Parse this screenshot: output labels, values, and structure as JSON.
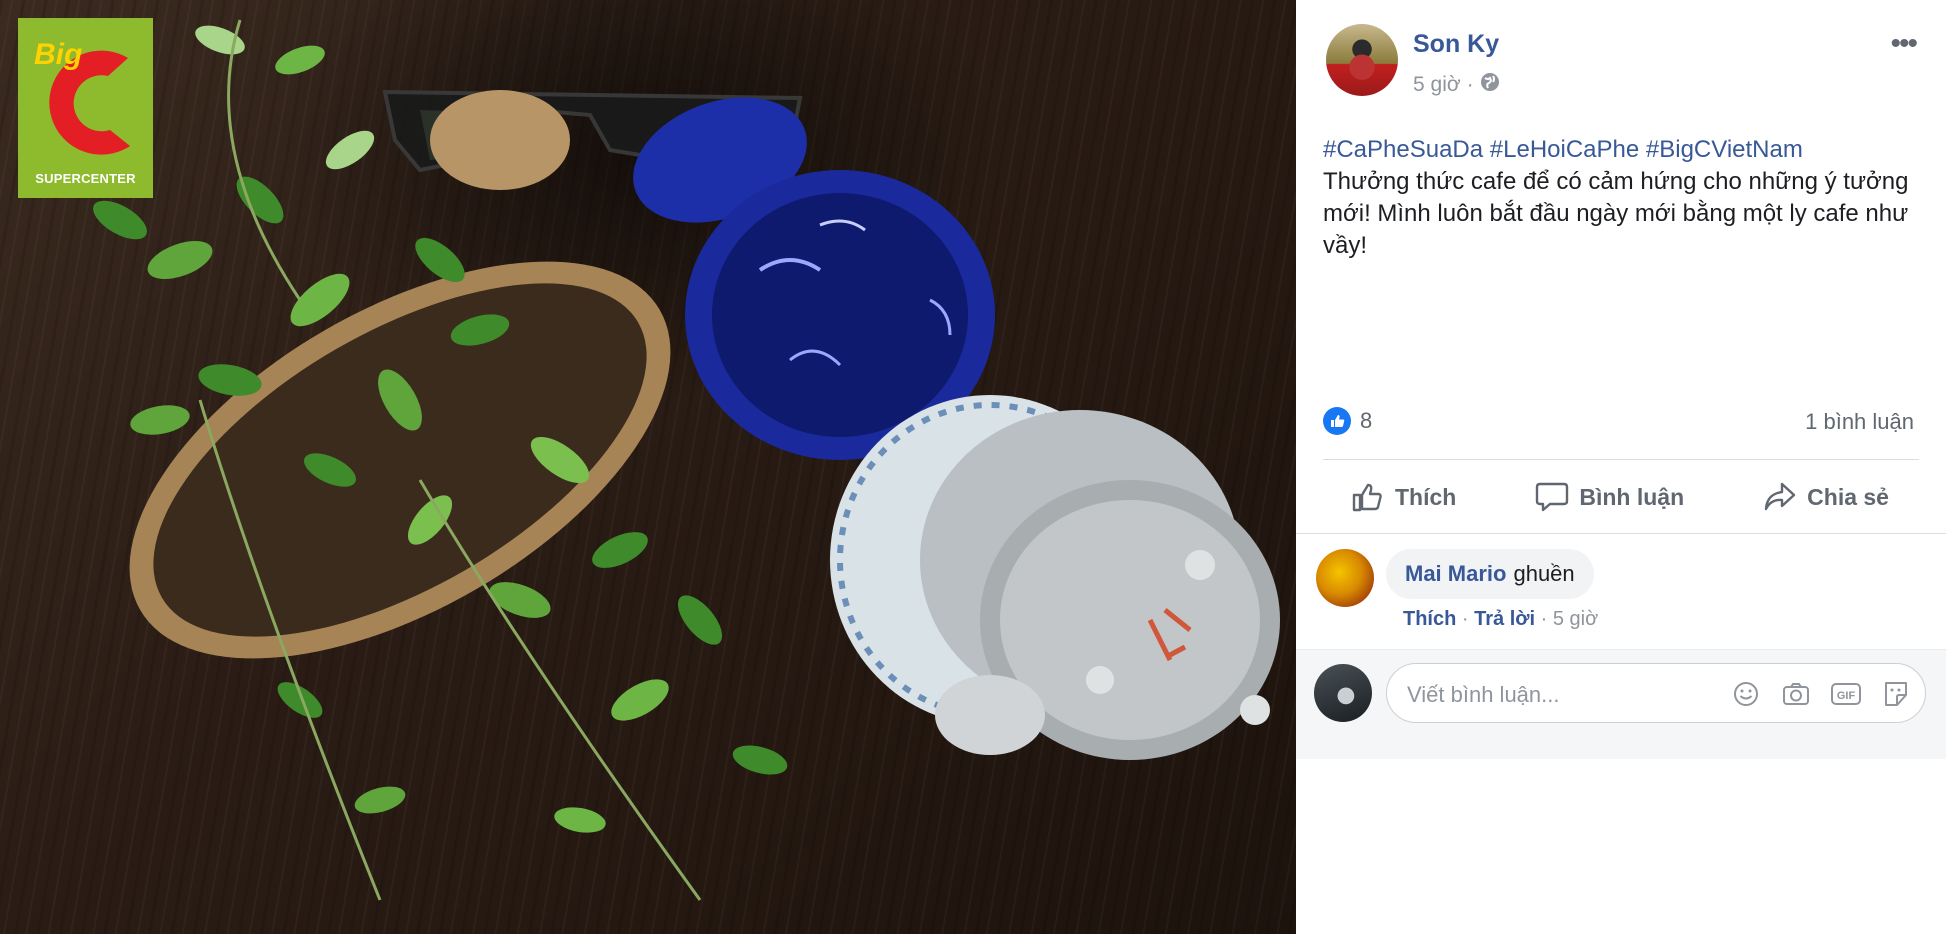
{
  "photo": {
    "logo_word": "Big",
    "logo_letter": "C",
    "logo_caption": "SUPERCENTER",
    "brand_color": "#8dbb2d",
    "brand_red": "#e31e24",
    "brand_yellow": "#ffd200"
  },
  "post": {
    "author": "Son Ky",
    "time": "5 giờ",
    "privacy_icon": "globe-icon",
    "more_icon": "more-icon",
    "more_label": "•••",
    "hashtags": "#CaPheSuaDa #LeHoiCaPhe #BigCVietNam",
    "text": "Thưởng thức cafe để có cảm hứng cho những ý tưởng mới! Mình luôn bắt đầu ngày mới bằng một ly cafe như vầy!",
    "like_count": "8",
    "comment_count": "1 bình luận"
  },
  "actions": {
    "like": "Thích",
    "comment": "Bình luận",
    "share": "Chia sẻ"
  },
  "comments": [
    {
      "author": "Mai Mario",
      "text": "ghuền",
      "like": "Thích",
      "reply": "Trả lời",
      "time": "5 giờ"
    }
  ],
  "composer": {
    "placeholder": "Viết bình luận...",
    "icons": [
      "emoji-icon",
      "camera-icon",
      "gif-icon",
      "sticker-icon"
    ]
  },
  "colors": {
    "link": "#385898",
    "secondary": "#90949c",
    "like_blue": "#1877f2"
  }
}
